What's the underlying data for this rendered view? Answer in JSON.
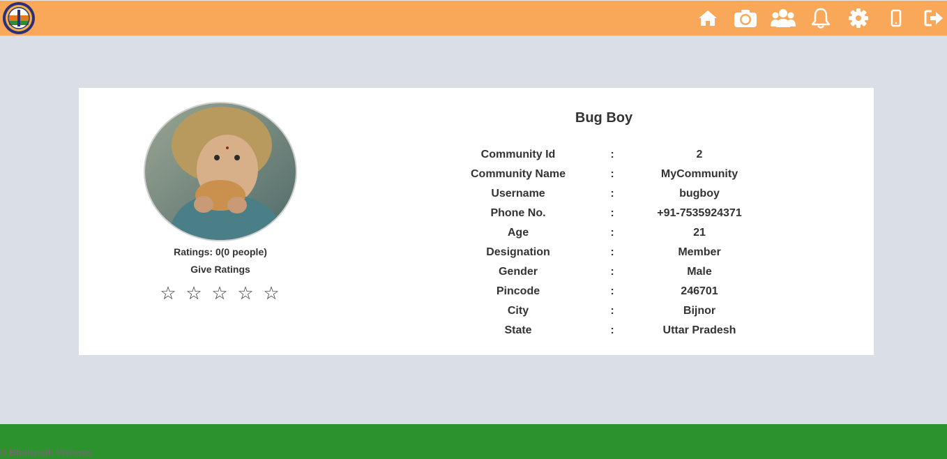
{
  "header": {
    "brand_color": "#f9a85a",
    "nav_icons": [
      "home-icon",
      "camera-icon",
      "users-icon",
      "bell-icon",
      "gear-icon",
      "mobile-icon",
      "logout-icon"
    ]
  },
  "profile": {
    "name": "Bug Boy",
    "ratings_text": "Ratings: 0(0 people)",
    "give_ratings_label": "Give Ratings",
    "stars": [
      "☆",
      "☆",
      "☆",
      "☆",
      "☆"
    ],
    "separator": ":",
    "fields": [
      {
        "label": "Community Id",
        "value": "2"
      },
      {
        "label": "Community Name",
        "value": "MyCommunity"
      },
      {
        "label": "Username",
        "value": "bugboy"
      },
      {
        "label": "Phone No.",
        "value": "+91-7535924371"
      },
      {
        "label": "Age",
        "value": "21"
      },
      {
        "label": "Designation",
        "value": "Member"
      },
      {
        "label": "Gender",
        "value": "Male"
      },
      {
        "label": "Pincode",
        "value": "246701"
      },
      {
        "label": "City",
        "value": "Bijnor"
      },
      {
        "label": "State",
        "value": "Uttar Pradesh"
      }
    ]
  },
  "footer": {
    "copyright": "© Bholanath Vishwas",
    "color": "#2b922d"
  }
}
